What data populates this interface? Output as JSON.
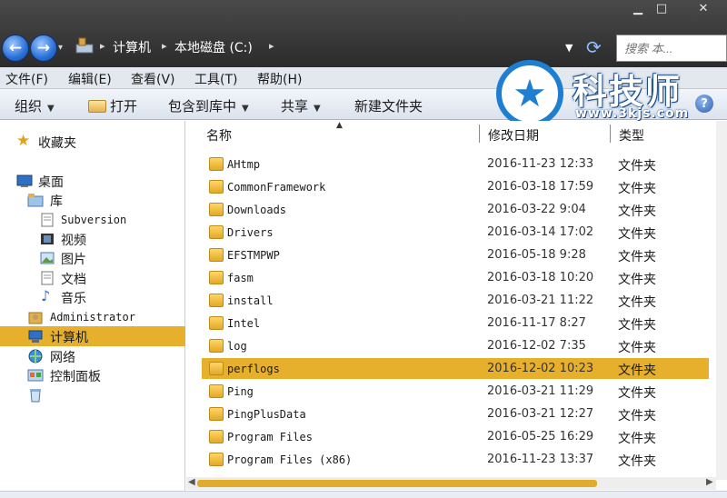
{
  "window": {
    "minimize": "▁",
    "maximize": "□",
    "close": "✕"
  },
  "nav": {
    "back": "←",
    "forward": "→",
    "history": "▾"
  },
  "breadcrumb": [
    "计算机",
    "本地磁盘 (C:)"
  ],
  "search": {
    "placeholder": "搜索 本..."
  },
  "menu": [
    "文件(F)",
    "编辑(E)",
    "查看(V)",
    "工具(T)",
    "帮助(H)"
  ],
  "toolbar": {
    "organize": "组织",
    "open": "打开",
    "include_library": "包含到库中",
    "share": "共享",
    "new_folder": "新建文件夹",
    "help": "?"
  },
  "watermark": {
    "title": "科技师",
    "url": "www.3kjs.com"
  },
  "sidebar": {
    "favorites": "收藏夹",
    "desktop": "桌面",
    "library": "库",
    "subversion": "Subversion",
    "videos": "视频",
    "pictures": "图片",
    "documents": "文档",
    "music": "音乐",
    "administrator": "Administrator",
    "computer": "计算机",
    "network": "网络",
    "control_panel": "控制面板"
  },
  "columns": {
    "name": "名称",
    "modified": "修改日期",
    "type": "类型"
  },
  "files": [
    {
      "name": "AHtmp",
      "date": "2016-11-23 12:33",
      "type": "文件夹"
    },
    {
      "name": "CommonFramework",
      "date": "2016-03-18 17:59",
      "type": "文件夹"
    },
    {
      "name": "Downloads",
      "date": "2016-03-22 9:04",
      "type": "文件夹"
    },
    {
      "name": "Drivers",
      "date": "2016-03-14 17:02",
      "type": "文件夹"
    },
    {
      "name": "EFSTMPWP",
      "date": "2016-05-18 9:28",
      "type": "文件夹"
    },
    {
      "name": "fasm",
      "date": "2016-03-18 10:20",
      "type": "文件夹"
    },
    {
      "name": "install",
      "date": "2016-03-21 11:22",
      "type": "文件夹"
    },
    {
      "name": "Intel",
      "date": "2016-11-17 8:27",
      "type": "文件夹"
    },
    {
      "name": "log",
      "date": "2016-12-02 7:35",
      "type": "文件夹"
    },
    {
      "name": "perflogs",
      "date": "2016-12-02 10:23",
      "type": "文件夹"
    },
    {
      "name": "Ping",
      "date": "2016-03-21 11:29",
      "type": "文件夹"
    },
    {
      "name": "PingPlusData",
      "date": "2016-03-21 12:27",
      "type": "文件夹"
    },
    {
      "name": "Program Files",
      "date": "2016-05-25 16:29",
      "type": "文件夹"
    },
    {
      "name": "Program Files (x86)",
      "date": "2016-11-23 13:37",
      "type": "文件夹"
    }
  ],
  "accent": {
    "selection": "#e7b02c",
    "folder": "#e1a928",
    "watermark": "#1e7fd1"
  }
}
